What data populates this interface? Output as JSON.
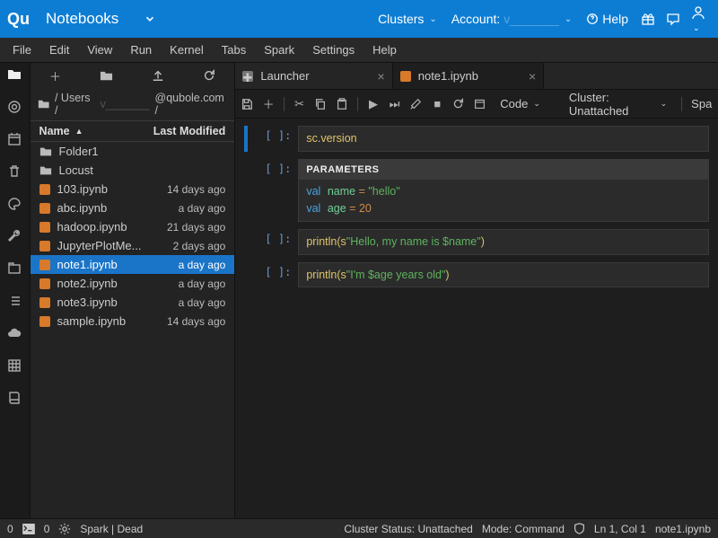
{
  "topbar": {
    "logo": "Qu",
    "crumb": "Notebooks",
    "clusters": "Clusters",
    "account": "Account:",
    "help": "Help"
  },
  "menus": [
    "File",
    "Edit",
    "View",
    "Run",
    "Kernel",
    "Tabs",
    "Spark",
    "Settings",
    "Help"
  ],
  "breadcrumb": {
    "root": "/ Users /",
    "path": "@qubole.com /"
  },
  "fbheader": {
    "name": "Name",
    "modified": "Last Modified"
  },
  "files": [
    {
      "type": "folder",
      "name": "Folder1",
      "mod": ""
    },
    {
      "type": "folder",
      "name": "Locust",
      "mod": ""
    },
    {
      "type": "nb",
      "name": "103.ipynb",
      "mod": "14 days ago"
    },
    {
      "type": "nb",
      "name": "abc.ipynb",
      "mod": "a day ago"
    },
    {
      "type": "nb",
      "name": "hadoop.ipynb",
      "mod": "21 days ago"
    },
    {
      "type": "nb",
      "name": "JupyterPlotMe...",
      "mod": "2 days ago"
    },
    {
      "type": "nb",
      "name": "note1.ipynb",
      "mod": "a day ago",
      "selected": true
    },
    {
      "type": "nb",
      "name": "note2.ipynb",
      "mod": "a day ago"
    },
    {
      "type": "nb",
      "name": "note3.ipynb",
      "mod": "a day ago"
    },
    {
      "type": "nb",
      "name": "sample.ipynb",
      "mod": "14 days ago"
    }
  ],
  "tabs": [
    {
      "label": "Launcher",
      "active": false,
      "icon": "grey"
    },
    {
      "label": "note1.ipynb",
      "active": true,
      "icon": "orange"
    }
  ],
  "nbtool": {
    "code": "Code",
    "cluster": "Cluster: Unattached",
    "spark": "Spark"
  },
  "prompt": "[ ]:",
  "cells": {
    "c0": {
      "sc": "sc",
      "dot": ".",
      "ver": "version"
    },
    "c1": {
      "hdr": "PARAMETERS",
      "kw": "val",
      "name": "name",
      "eq": " = ",
      "s1": "\"hello\"",
      "age": "age",
      "n": "20"
    },
    "c2": {
      "pr": "println",
      "op": "(",
      "s": "s",
      "msg": "\"Hello, my name is $name\"",
      "cp": ")"
    },
    "c3": {
      "pr": "println",
      "op": "(",
      "s": "s",
      "msg": "\"I'm $age years old\"",
      "cp": ")"
    }
  },
  "status": {
    "l0": "0",
    "l1": "0",
    "l2": "Spark | Dead",
    "r0": "Cluster Status: Unattached",
    "r1": "Mode: Command",
    "r2": "Ln 1, Col 1",
    "r3": "note1.ipynb"
  }
}
